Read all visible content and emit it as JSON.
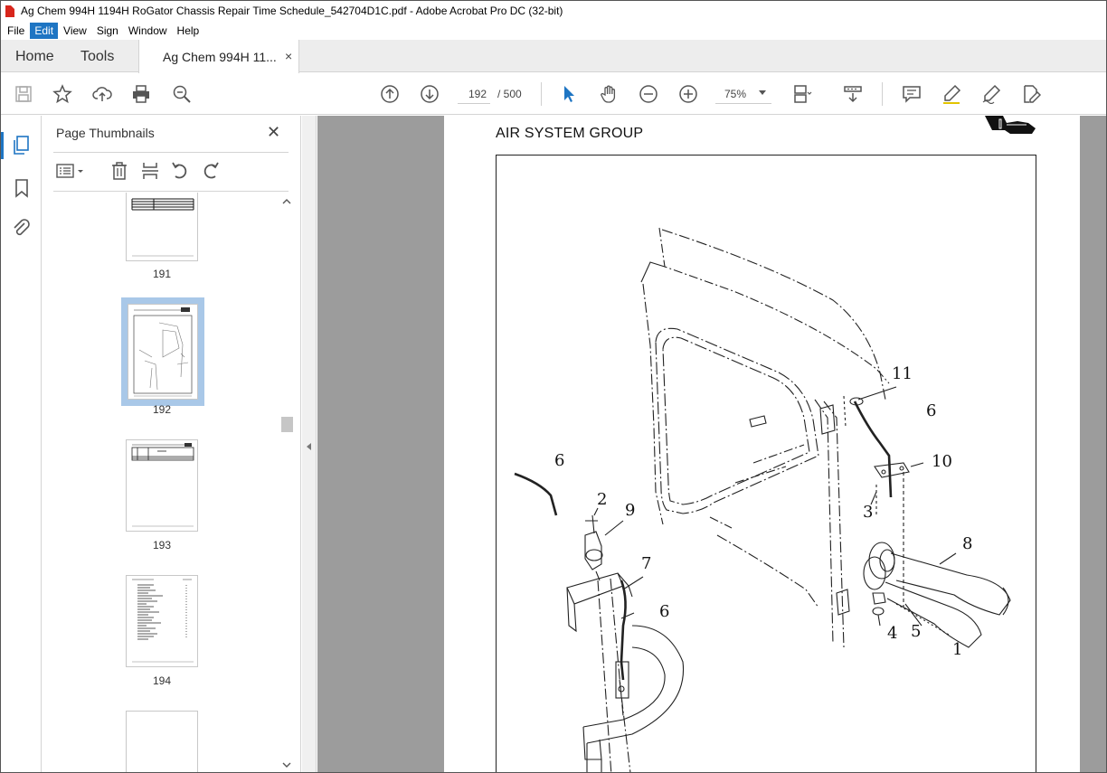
{
  "window": {
    "title": "Ag Chem 994H 1194H RoGator Chassis Repair Time Schedule_542704D1C.pdf - Adobe Acrobat Pro DC (32-bit)"
  },
  "menu": [
    "File",
    "Edit",
    "View",
    "Sign",
    "Window",
    "Help"
  ],
  "tabs": {
    "home": "Home",
    "tools": "Tools",
    "document": "Ag Chem 994H 11...",
    "close": "×"
  },
  "toolbar": {
    "current_page": "192",
    "total_pages": "/ 500",
    "zoom": "75%"
  },
  "panel": {
    "title": "Page Thumbnails",
    "close": "✕",
    "thumbnails": [
      {
        "page": "191",
        "selected": false
      },
      {
        "page": "192",
        "selected": true
      },
      {
        "page": "193",
        "selected": false
      },
      {
        "page": "194",
        "selected": false
      }
    ]
  },
  "document": {
    "heading": "AIR SYSTEM GROUP",
    "callouts": [
      "11",
      "6",
      "10",
      "3",
      "6",
      "2",
      "9",
      "7",
      "8",
      "6",
      "4",
      "5",
      "1"
    ]
  },
  "colors": {
    "accent": "#1e75c3",
    "pdf_red": "#d8261c",
    "doc_background": "#9c9c9c",
    "thumbnail_selection": "#a9c8e8"
  }
}
